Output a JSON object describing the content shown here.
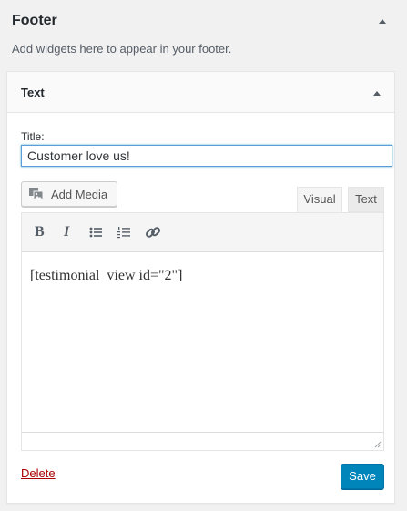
{
  "sidebar_area": {
    "title": "Footer",
    "description": "Add widgets here to appear in your footer."
  },
  "widget": {
    "title": "Text",
    "title_field_label": "Title:",
    "title_field_value": "Customer love us!",
    "add_media_label": "Add Media",
    "tabs": {
      "visual": "Visual",
      "text": "Text"
    },
    "active_tab": "Visual",
    "toolbar_icons": [
      "bold-icon",
      "italic-icon",
      "bulleted-list-icon",
      "numbered-list-icon",
      "link-icon"
    ],
    "content": "[testimonial_view id=\"2\"]",
    "delete_label": "Delete",
    "save_label": "Save"
  },
  "colors": {
    "primary_button": "#0085ba",
    "delete_link": "#a00000",
    "focus_border": "#5b9dd9"
  }
}
